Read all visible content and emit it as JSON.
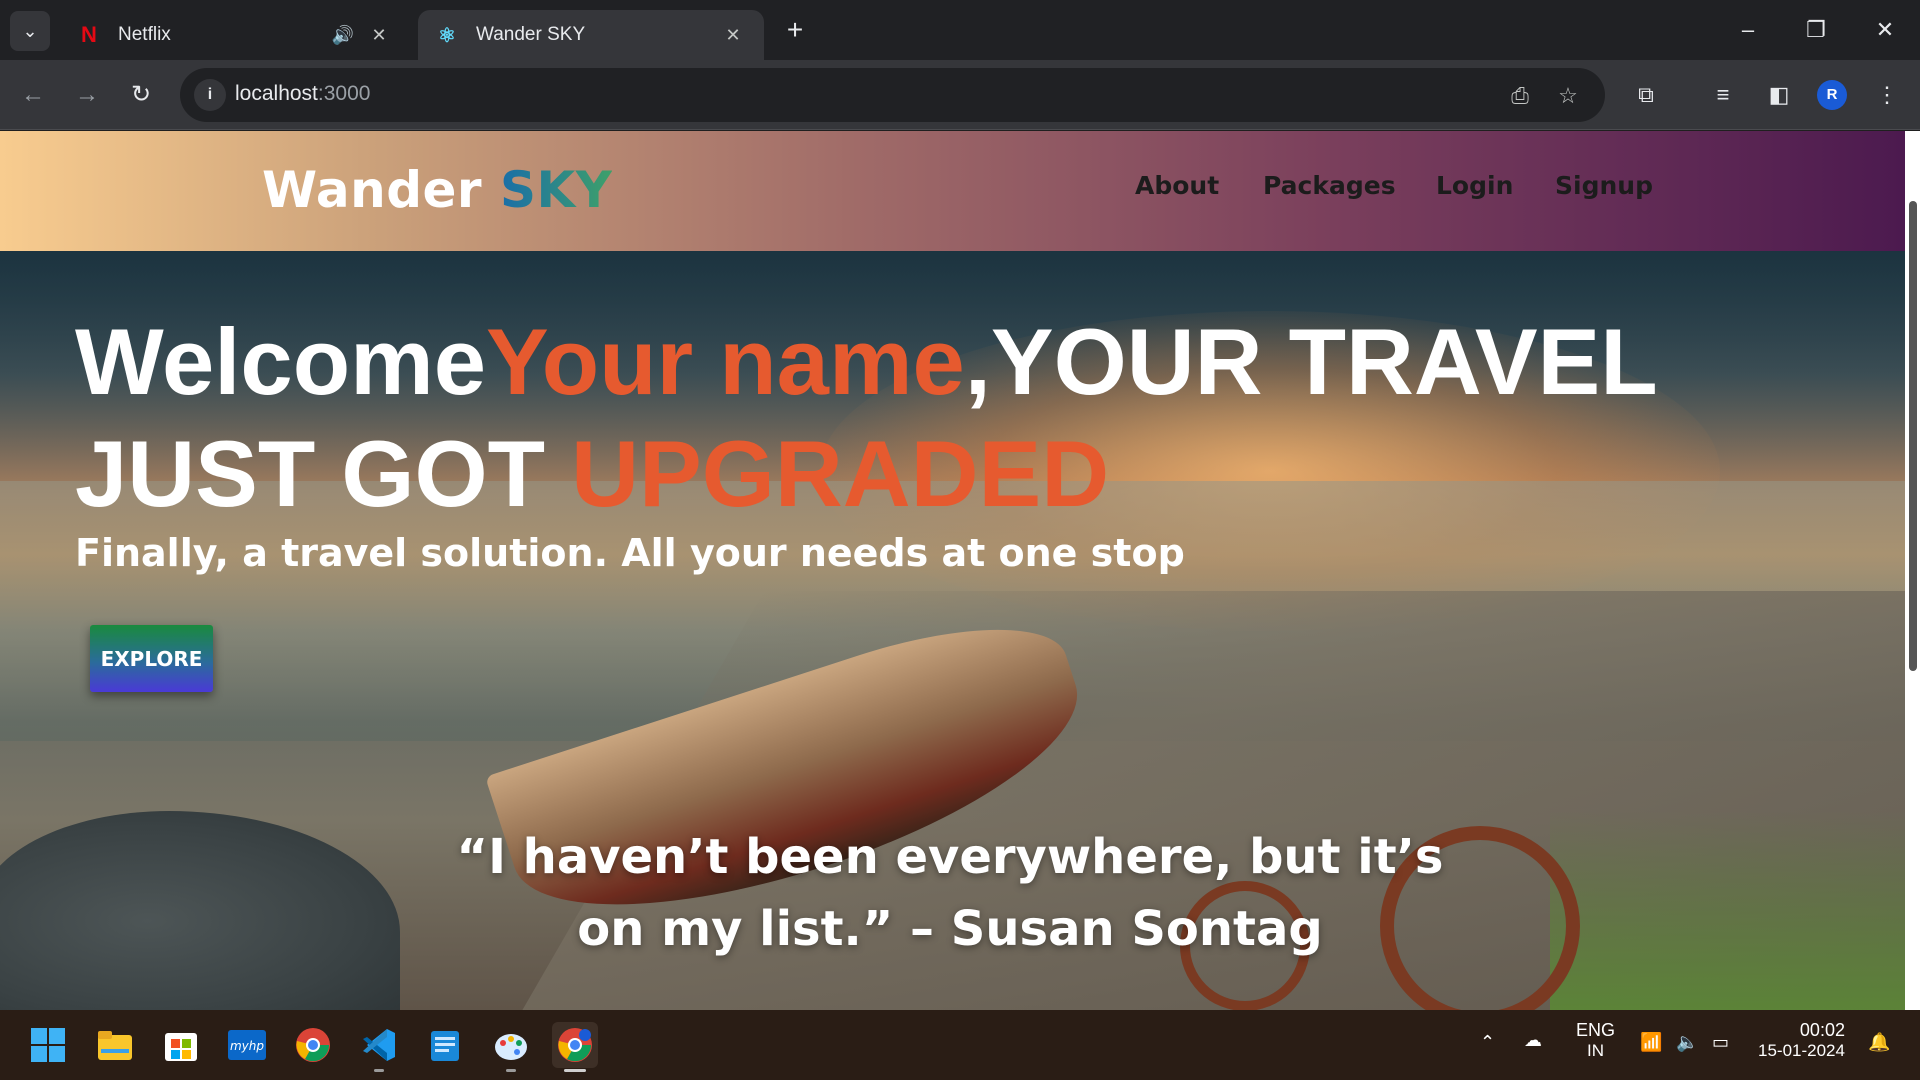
{
  "browser": {
    "tabs": [
      {
        "title": "Netflix",
        "favicon": "netflix-n",
        "audio": true
      },
      {
        "title": "Wander SKY",
        "favicon": "react-atom",
        "active": true
      }
    ],
    "url_host": "localhost",
    "url_port": ":3000"
  },
  "site": {
    "brand_main": "Wander",
    "brand_accent": "SKY",
    "nav": [
      "About",
      "Packages",
      "Login",
      "Signup"
    ],
    "headline_welcome": "Welcome",
    "headline_name": "Your name",
    "headline_mid": ",YOUR TRAVEL",
    "headline_line2_a": "JUST GOT ",
    "headline_line2_b": "UPGRADED",
    "subhead": "Finally, a travel solution. All your needs at one stop",
    "explore_label": "EXPLORE",
    "quote_line1": "“I haven’t been everywhere, but it’s",
    "quote_line2": "on my list.” – Susan Sontag",
    "colors": {
      "accent": "#e65a2f",
      "nav_gradient_start": "#f8cc8f",
      "nav_gradient_end": "#4c1a4f"
    }
  },
  "taskbar": {
    "apps": [
      "windows-start",
      "file-explorer",
      "microsoft-store",
      "myhp",
      "chrome",
      "vscode",
      "notepad",
      "paint",
      "chrome-profile"
    ],
    "lang_top": "ENG",
    "lang_bottom": "IN",
    "time": "00:02",
    "date": "15-01-2024"
  }
}
